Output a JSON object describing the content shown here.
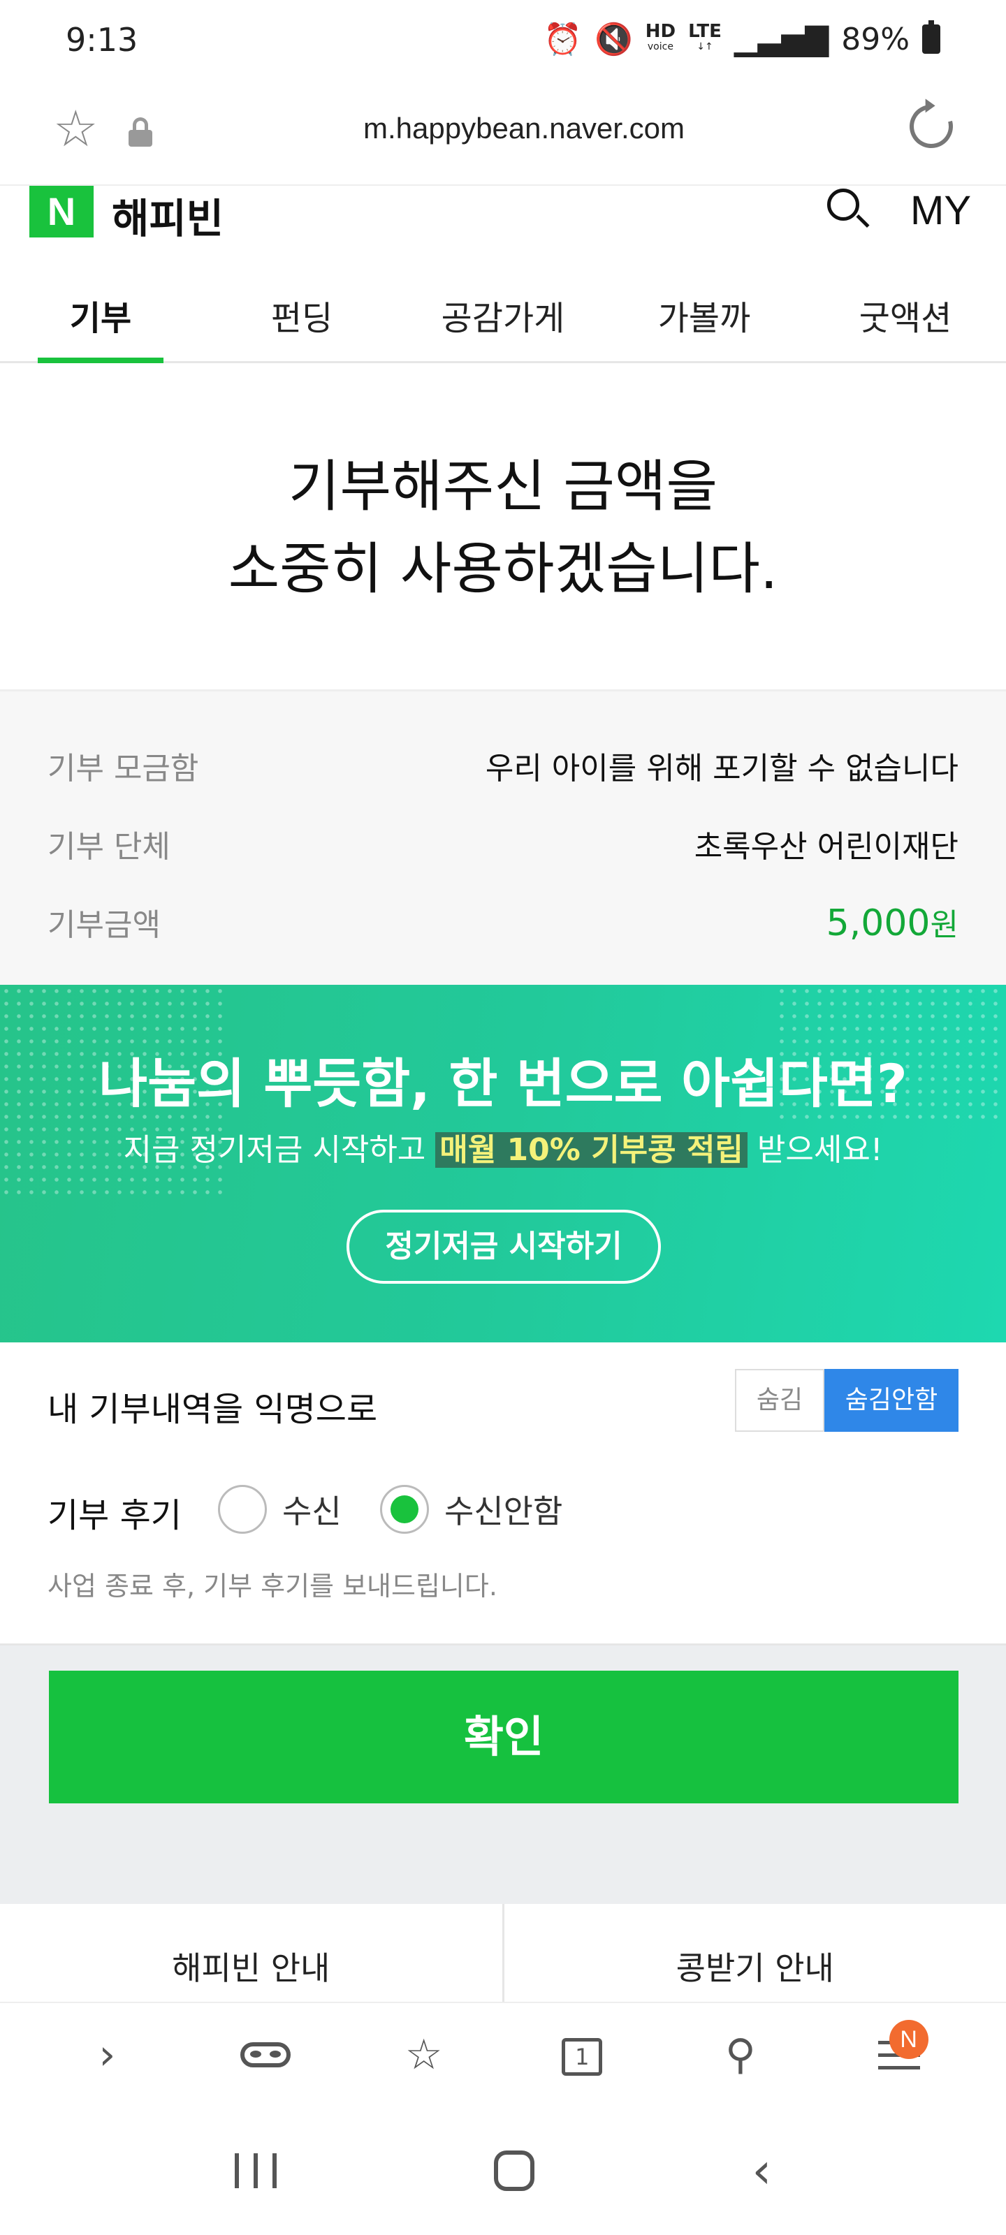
{
  "status_bar": {
    "time": "9:13",
    "hd": "HD",
    "hd_sub": "voice",
    "lte": "LTE",
    "battery": "89%"
  },
  "browser": {
    "url": "m.happybean.naver.com"
  },
  "site": {
    "logo_letter": "N",
    "logo_text": "해피빈",
    "my_label": "MY"
  },
  "tabs": [
    {
      "label": "기부",
      "active": true
    },
    {
      "label": "펀딩"
    },
    {
      "label": "공감가게"
    },
    {
      "label": "가볼까"
    },
    {
      "label": "굿액션"
    }
  ],
  "thanks": {
    "line1": "기부해주신 금액을",
    "line2": "소중히 사용하겠습니다."
  },
  "info": [
    {
      "label": "기부 모금함",
      "value": "우리 아이를 위해 포기할 수 없습니다"
    },
    {
      "label": "기부 단체",
      "value": "초록우산 어린이재단"
    },
    {
      "label": "기부금액",
      "value": "5,000",
      "unit": "원"
    }
  ],
  "banner": {
    "title": "나눔의 뿌듯함, 한 번으로 아쉽다면?",
    "sub_pre": "지금 정기저금 시작하고 ",
    "sub_highlight": "매월 10% 기부콩 적립",
    "sub_post": " 받으세요!",
    "button": "정기저금 시작하기",
    "colors": {
      "start": "#26c48a",
      "end": "#1ed8b0",
      "highlight_text": "#f4f27a"
    }
  },
  "anonymous": {
    "label": "내 기부내역을 익명으로",
    "options": [
      "숨김",
      "숨김안함"
    ],
    "selected": "숨김안함"
  },
  "review": {
    "label": "기부 후기",
    "options": [
      "수신",
      "수신안함"
    ],
    "selected": "수신안함",
    "note": "사업 종료 후, 기부 후기를 보내드립니다."
  },
  "confirm_button": "확인",
  "footer_links": [
    "해피빈 안내",
    "콩받기 안내"
  ],
  "toolbar": {
    "badge": "N",
    "tabs_count": "1"
  },
  "accent_colors": {
    "brand_green": "#19c23d",
    "toggle_blue": "#2f87e8",
    "amount_green": "#13a838",
    "badge_orange": "#f26b2f"
  }
}
